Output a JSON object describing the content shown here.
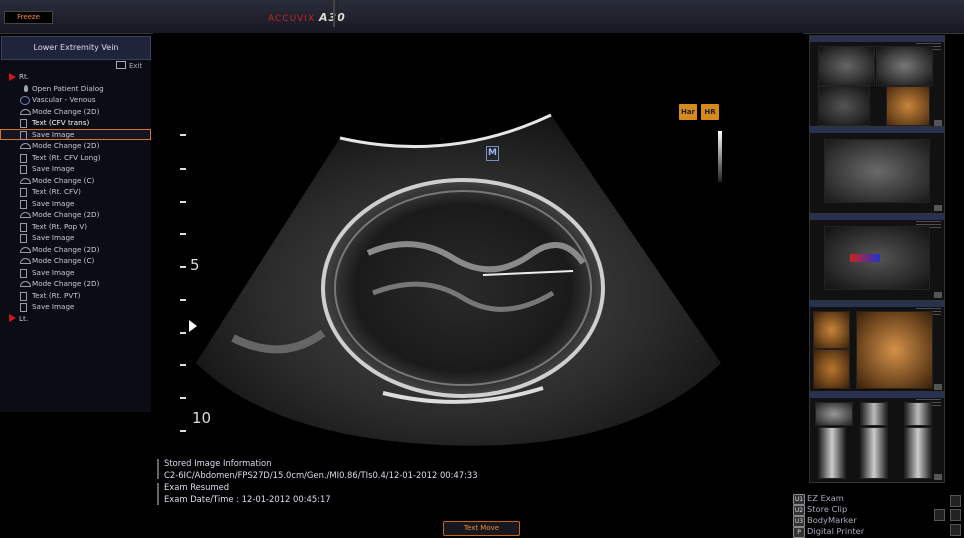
{
  "topbar": {
    "freeze_label": "Freeze",
    "brand_prefix": "ACCUVIX",
    "brand_model": "A30"
  },
  "protocol": {
    "title": "Lower Extremity Vein",
    "exit_label": "Exit",
    "steps": [
      {
        "label": "Rt.",
        "icon": "red-triangle-icon"
      },
      {
        "label": "Open Patient Dialog",
        "icon": "person-icon"
      },
      {
        "label": "Vascular - Venous",
        "icon": "vascular-icon"
      },
      {
        "label": "Mode Change (2D)",
        "icon": "mode-icon"
      },
      {
        "label": "Text (CFV trans)",
        "icon": "text-icon"
      },
      {
        "label": "Save Image",
        "icon": "save-icon"
      },
      {
        "label": "Mode Change (2D)",
        "icon": "mode-icon"
      },
      {
        "label": "Text (Rt. CFV Long)",
        "icon": "text-icon"
      },
      {
        "label": "Save Image",
        "icon": "save-icon"
      },
      {
        "label": "Mode Change (C)",
        "icon": "mode-icon"
      },
      {
        "label": "Text (Rt. CFV)",
        "icon": "text-icon"
      },
      {
        "label": "Save Image",
        "icon": "save-icon"
      },
      {
        "label": "Mode Change (2D)",
        "icon": "mode-icon"
      },
      {
        "label": "Text (Rt. Pop V)",
        "icon": "text-icon"
      },
      {
        "label": "Save Image",
        "icon": "save-icon"
      },
      {
        "label": "Mode Change (2D)",
        "icon": "mode-icon"
      },
      {
        "label": "Mode Change (C)",
        "icon": "mode-icon"
      },
      {
        "label": "Save Image",
        "icon": "save-icon"
      },
      {
        "label": "Mode Change (2D)",
        "icon": "mode-icon"
      },
      {
        "label": "Text (Rt. PVT)",
        "icon": "text-icon"
      },
      {
        "label": "Save Image",
        "icon": "save-icon"
      },
      {
        "label": "Lt.",
        "icon": "red-triangle-icon"
      }
    ],
    "selected_step": 5
  },
  "image": {
    "marker": "M",
    "badges": [
      "Har",
      "HR"
    ],
    "depth_labels": [
      "5",
      "10"
    ]
  },
  "stored_info": {
    "heading": "Stored Image Information",
    "line": "C2-6IC/Abdomen/FPS27D/15.0cm/Gen./MI0.86/TIs0.4/12-01-2012 00:47:33",
    "status": "Exam Resumed",
    "date_label": "Exam Date/Time : 12-01-2012 00:45:17"
  },
  "bottom": {
    "text_move_label": "Text Move"
  },
  "softkeys": [
    {
      "key": "U1",
      "label": "EZ Exam"
    },
    {
      "key": "U2",
      "label": "Store Clip"
    },
    {
      "key": "U3",
      "label": "BodyMarker"
    },
    {
      "key": "P",
      "label": "Digital Printer"
    }
  ],
  "colors": {
    "accent_orange": "#d6891c",
    "marker_red": "#cc1a1a",
    "selection": "#d8742a"
  }
}
